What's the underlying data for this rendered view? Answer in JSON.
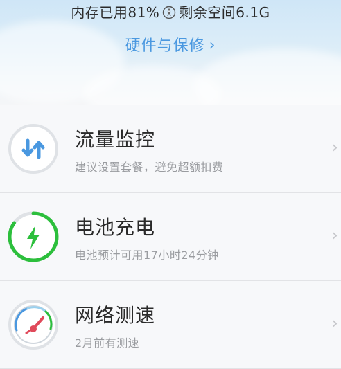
{
  "header": {
    "memory_used_text": "内存已用81%",
    "storage_free_text": "剩余空间6.1G",
    "hardware_link": "硬件与保修",
    "rocket_icon": "rocket-icon"
  },
  "items": [
    {
      "title": "流量监控",
      "subtitle": "建议设置套餐，避免超额扣费",
      "icon": "data-transfer-icon"
    },
    {
      "title": "电池充电",
      "subtitle": "电池预计可用17小时24分钟",
      "icon": "battery-charge-icon",
      "ring_color": "#2cbf3c"
    },
    {
      "title": "网络测速",
      "subtitle": "2月前有测速",
      "icon": "speedometer-icon"
    }
  ],
  "colors": {
    "accent_blue": "#4a98e0",
    "green": "#2cbf3c",
    "gauge_red": "#e0495a"
  }
}
